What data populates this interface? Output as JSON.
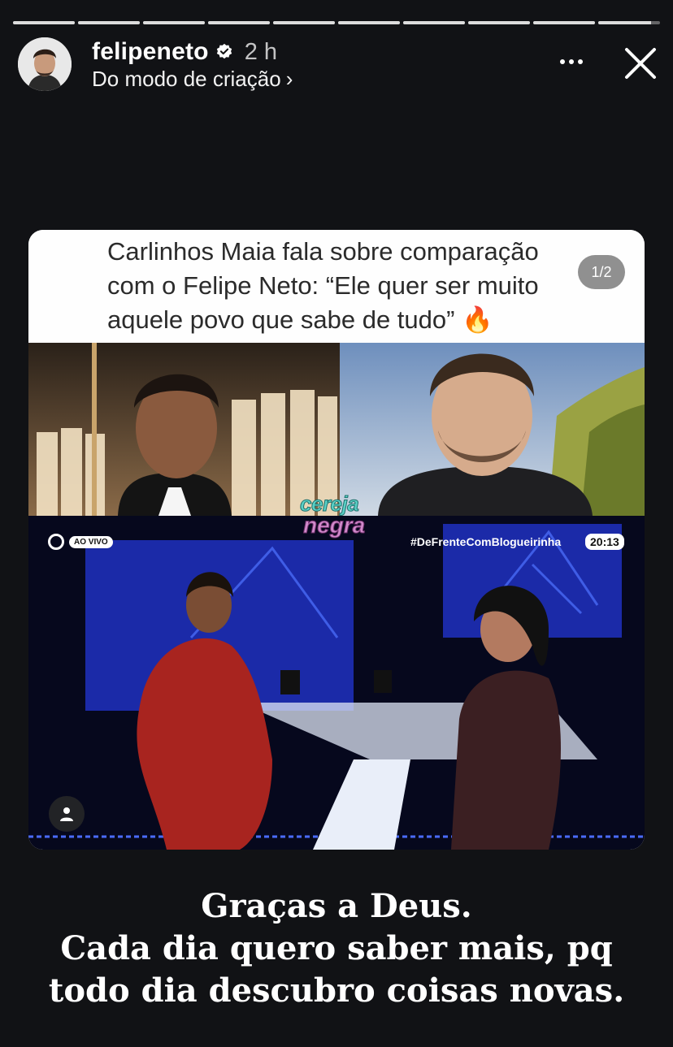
{
  "progress": {
    "segments": 10,
    "current_index": 9,
    "current_fill": 0.85
  },
  "header": {
    "username": "felipeneto",
    "verified": true,
    "time": "2 h",
    "subtitle": "Do modo de criação",
    "subtitle_chevron": "›",
    "more_icon": "more-horizontal-icon",
    "close_icon": "close-icon"
  },
  "post": {
    "headline_lines": [
      "Carlinhos Maia fala sobre comparação",
      "com o Felipe Neto: “Ele quer ser muito",
      "aquele povo que sabe de tudo” 🔥"
    ],
    "page_indicator": "1/2",
    "logo_line1": "cereja",
    "logo_line2": "negra",
    "live_label": "AO VIVO",
    "hashtag": "#DeFrenteComBlogueirinha",
    "clock": "20:13"
  },
  "caption_lines": [
    "Graças a Deus.",
    "Cada dia quero saber mais, pq",
    "todo dia descubro coisas novas."
  ],
  "colors": {
    "background": "#111215",
    "progress_active": "#dcdcdc",
    "studio_blue": "#1b2aa8"
  }
}
